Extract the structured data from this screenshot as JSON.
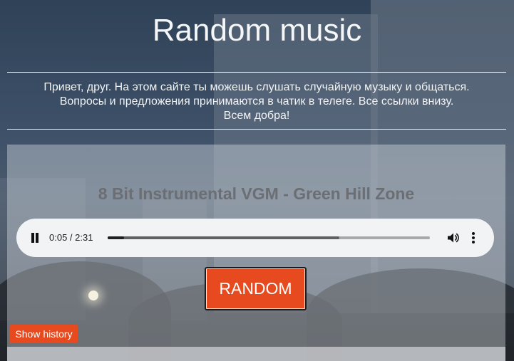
{
  "header": {
    "title": "Random music"
  },
  "intro": {
    "line1": "Привет, друг. На этом сайте ты можешь слушать случайную музыку и общаться.",
    "line2": "Вопросы и предложения принимаются в чатик в телеге. Все ссылки внизу.",
    "line3": "Всем добра!"
  },
  "player": {
    "track_title": "8 Bit Instrumental VGM - Green Hill Zone",
    "time_display": "0:05 / 2:31",
    "state": "playing",
    "progress_fraction": 0.05,
    "buffered_fraction": 0.72
  },
  "actions": {
    "random_label": "RANDOM",
    "history_label": "Show history"
  },
  "colors": {
    "accent": "#e84a1f"
  }
}
